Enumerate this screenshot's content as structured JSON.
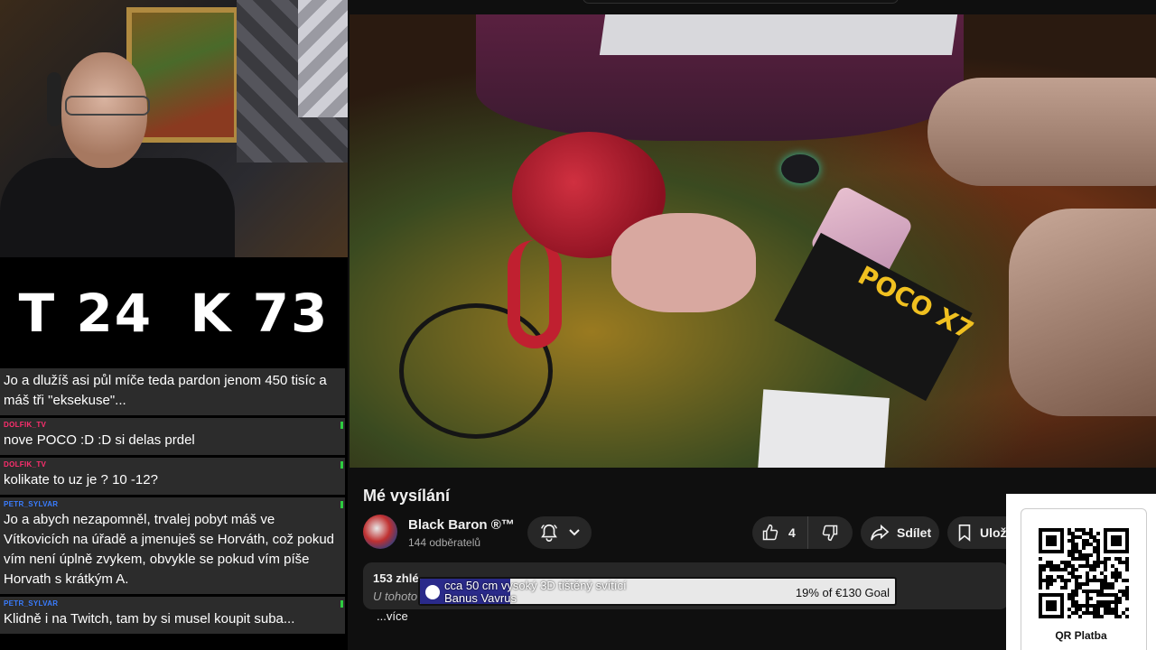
{
  "scoreboard": {
    "left": "T 24",
    "right": "K 73"
  },
  "chat": [
    {
      "user": "",
      "text": "Jo a dlužíš asi půl míče teda pardon jenom 450 tisíc a máš tři \"eksekuse\"...",
      "user_color": "#ff2e6e"
    },
    {
      "user": "DOLFIK_TV",
      "text": "nove POCO :D :D si delas prdel",
      "user_color": "#ff2e6e"
    },
    {
      "user": "DOLFIK_TV",
      "text": "kolikate to uz je ? 10 -12?",
      "user_color": "#ff2e6e"
    },
    {
      "user": "PETR_SYLVAR",
      "text": "Jo a abych nezapomněl, trvalej pobyt máš ve Vítkovicích na úřadě a jmenuješ se Horváth, což pokud vím není úplně zvykem, obvykle se pokud vím píše Horvath s krátkým A.",
      "user_color": "#3a7dff"
    },
    {
      "user": "PETR_SYLVAR",
      "text": "Klidně i na Twitch, tam by si musel koupit suba...",
      "user_color": "#3a7dff"
    }
  ],
  "video": {
    "box_label": "POCO X7"
  },
  "info": {
    "title": "Mé vysílání",
    "channel_name": "Black Baron ®™",
    "subscribers": "144 odběratelů",
    "likes": "4",
    "share_label": "Sdílet",
    "save_label": "Ulož",
    "views": "153 zhlé",
    "desc_snippet": "U tohoto",
    "more_label": "...více"
  },
  "goal": {
    "line1": "cca 50 cm vysoký 3D tištěný svítící",
    "line2": "Banus Vavrus",
    "amount_text": "19% of €130 Goal",
    "progress": 0.19,
    "fill_color": "#2a2a8a"
  },
  "qr": {
    "label": "QR Platba"
  }
}
